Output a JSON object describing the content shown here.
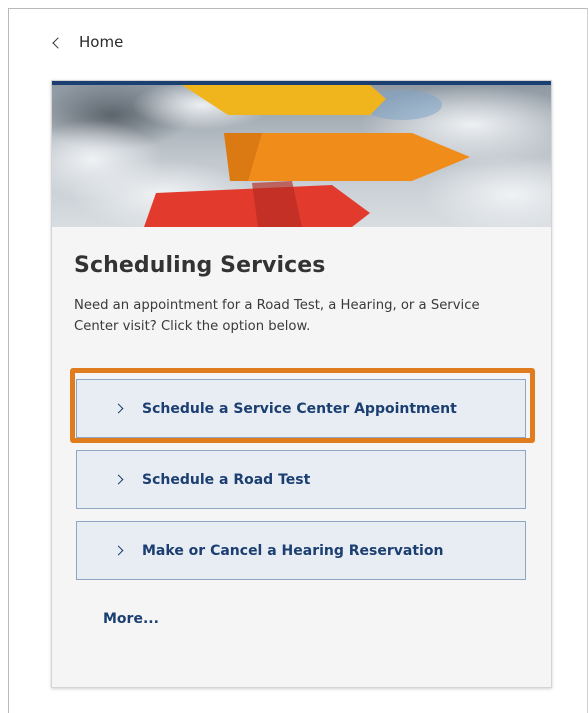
{
  "breadcrumb": {
    "back_label": "Home"
  },
  "card": {
    "title": "Scheduling Services",
    "description": "Need an appointment for a Road Test, a Hearing, or a Service Center visit? Click the option below.",
    "options": [
      {
        "label": "Schedule a Service Center Appointment",
        "highlighted": true
      },
      {
        "label": "Schedule a Road Test",
        "highlighted": false
      },
      {
        "label": "Make or Cancel a Hearing Reservation",
        "highlighted": false
      }
    ],
    "more_label": "More...",
    "hero_image": "colorful-signpost-arrows-against-cloudy-sky"
  },
  "colors": {
    "accent_navy": "#1c3f72",
    "highlight_orange": "#e07b1e",
    "option_bg": "#e8edf3",
    "card_bg": "#f5f5f5"
  }
}
